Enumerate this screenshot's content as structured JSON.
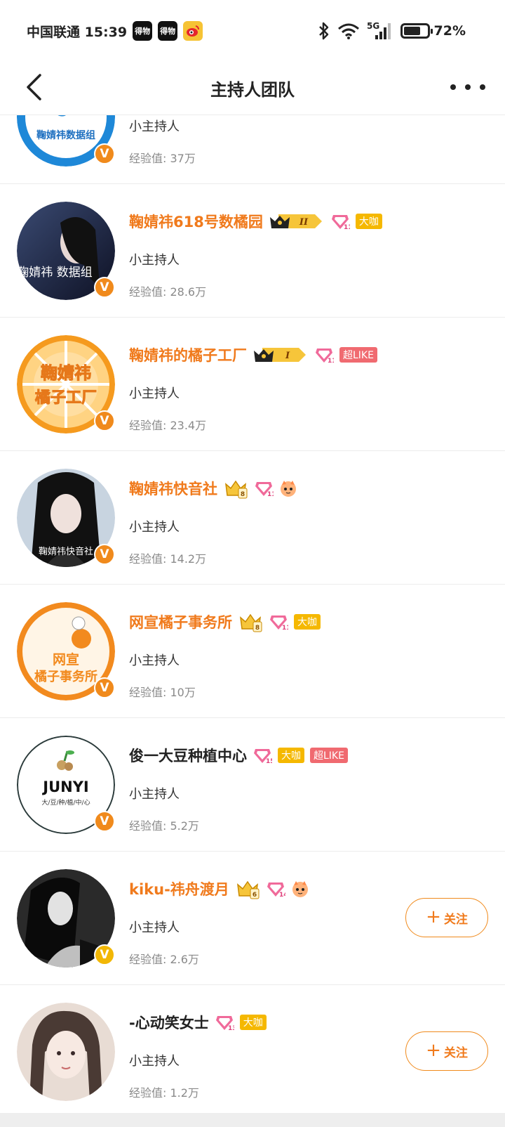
{
  "status_bar": {
    "carrier_time": "中国联通 15:39",
    "apps": [
      "得物",
      "得物",
      "微博"
    ],
    "network": "5G",
    "battery_level": 0.72,
    "battery_text": "72%"
  },
  "nav": {
    "title": "主持人团队"
  },
  "members": [
    {
      "name": "",
      "name_style": "orange",
      "avatar_text": "鞠婧祎数据组",
      "role": "小主持人",
      "exp": "经验值: 37万",
      "badges": [],
      "follow": false,
      "vbadge": "orange"
    },
    {
      "name": "鞠婧祎618号数橘园",
      "name_style": "orange",
      "avatar_text": "鞠婧祎 数据组",
      "role": "小主持人",
      "exp": "经验值: 28.6万",
      "badges": [
        "crown-II",
        "gem",
        "大咖"
      ],
      "follow": false,
      "vbadge": "orange"
    },
    {
      "name": "鞠婧祎的橘子工厂",
      "name_style": "orange",
      "avatar_text": "鞠婧祎的橘子工厂",
      "role": "小主持人",
      "exp": "经验值: 23.4万",
      "badges": [
        "crown-I",
        "gem",
        "超LIKE"
      ],
      "follow": false,
      "vbadge": "orange"
    },
    {
      "name": "鞠婧祎快音社",
      "name_style": "orange",
      "avatar_text": "鞠婧祎快音社",
      "role": "小主持人",
      "exp": "经验值: 14.2万",
      "badges": [
        "crown-small",
        "gem",
        "mascot"
      ],
      "follow": false,
      "vbadge": "orange"
    },
    {
      "name": "网宣橘子事务所",
      "name_style": "orange",
      "avatar_text": "网宣 橘子事务所",
      "role": "小主持人",
      "exp": "经验值: 10万",
      "badges": [
        "crown-small",
        "gem",
        "大咖"
      ],
      "follow": false,
      "vbadge": "orange"
    },
    {
      "name": "俊一大豆种植中心",
      "name_style": "dark",
      "avatar_text": "JUNYI",
      "avatar_sub": "大/豆/种/植/中/心",
      "role": "小主持人",
      "exp": "经验值: 5.2万",
      "badges": [
        "gem15",
        "大咖",
        "超LIKE"
      ],
      "follow": false,
      "vbadge": "orange"
    },
    {
      "name": "kiku-祎舟渡月",
      "name_style": "orange",
      "avatar_text": "",
      "role": "小主持人",
      "exp": "经验值: 2.6万",
      "badges": [
        "crown-small",
        "gem",
        "mascot"
      ],
      "follow": true,
      "vbadge": "yellow"
    },
    {
      "name": "-心动笑女士",
      "name_style": "dark",
      "avatar_text": "",
      "role": "小主持人",
      "exp": "经验值: 1.2万",
      "badges": [
        "gem",
        "大咖"
      ],
      "follow": true,
      "vbadge": "none"
    }
  ],
  "follow_label": "关注",
  "follow_plus": "+"
}
